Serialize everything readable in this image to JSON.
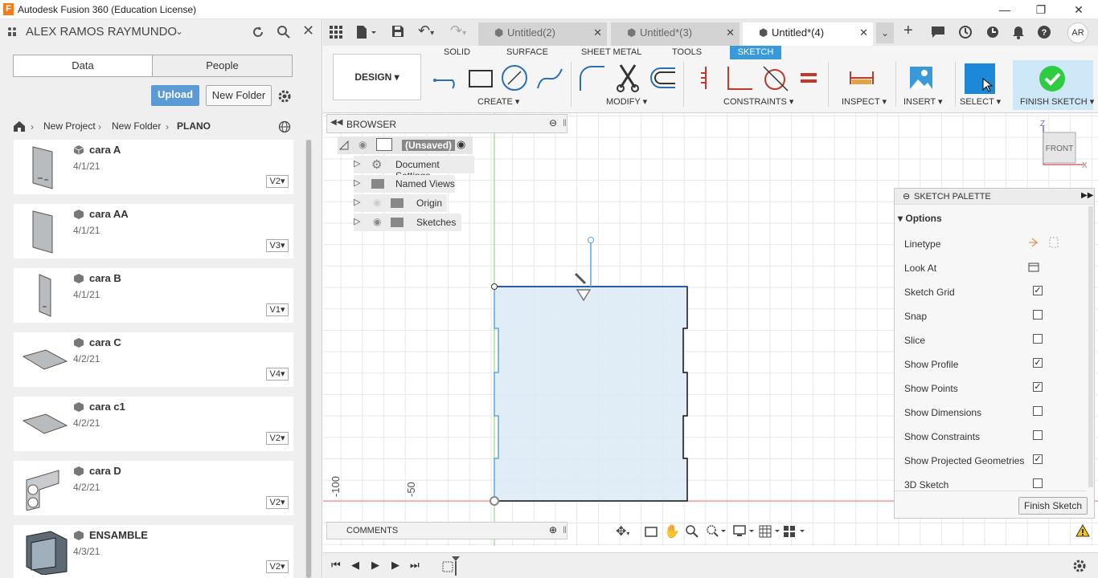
{
  "window": {
    "title": "Autodesk Fusion 360 (Education License)",
    "logo": "F"
  },
  "left": {
    "user": "ALEX RAMOS RAYMUNDO",
    "tabs": [
      "Data",
      "People"
    ],
    "upload": "Upload",
    "new_folder": "New Folder",
    "breadcrumb": [
      "New Project",
      "New Folder",
      "PLANO"
    ],
    "files": [
      {
        "name": "cara A",
        "date": "4/1/21",
        "version": "V2"
      },
      {
        "name": "cara AA",
        "date": "4/1/21",
        "version": "V3"
      },
      {
        "name": "cara B",
        "date": "4/1/21",
        "version": "V1"
      },
      {
        "name": "cara C",
        "date": "4/2/21",
        "version": "V4"
      },
      {
        "name": "cara c1",
        "date": "4/2/21",
        "version": "V2"
      },
      {
        "name": "cara D",
        "date": "4/2/21",
        "version": "V2"
      },
      {
        "name": "ENSAMBLE",
        "date": "4/3/21",
        "version": "V2"
      }
    ]
  },
  "doc_tabs": [
    "Untitled(2)",
    "Untitled*(3)",
    "Untitled*(4)"
  ],
  "user_initials": "AR",
  "ribbon": {
    "workspace": "DESIGN",
    "tabs": [
      "SOLID",
      "SURFACE",
      "SHEET METAL",
      "TOOLS",
      "SKETCH"
    ],
    "groups": [
      "CREATE",
      "MODIFY",
      "CONSTRAINTS",
      "INSPECT",
      "INSERT",
      "SELECT",
      "FINISH SKETCH"
    ]
  },
  "browser": {
    "title": "BROWSER",
    "root": "(Unsaved)",
    "items": [
      "Document Settings",
      "Named Views",
      "Origin",
      "Sketches"
    ]
  },
  "viewcube": {
    "face": "FRONT",
    "z": "Z",
    "x": "X"
  },
  "axis_ticks": [
    "-100",
    "-50"
  ],
  "palette": {
    "title": "SKETCH PALETTE",
    "section": "Options",
    "rows": [
      {
        "label": "Linetype",
        "type": "icons"
      },
      {
        "label": "Look At",
        "type": "icon"
      },
      {
        "label": "Sketch Grid",
        "checked": true
      },
      {
        "label": "Snap",
        "checked": false
      },
      {
        "label": "Slice",
        "checked": false
      },
      {
        "label": "Show Profile",
        "checked": true
      },
      {
        "label": "Show Points",
        "checked": true
      },
      {
        "label": "Show Dimensions",
        "checked": false
      },
      {
        "label": "Show Constraints",
        "checked": false
      },
      {
        "label": "Show Projected Geometries",
        "checked": true
      },
      {
        "label": "3D Sketch",
        "checked": false
      }
    ],
    "finish": "Finish Sketch"
  },
  "comments": "COMMENTS"
}
